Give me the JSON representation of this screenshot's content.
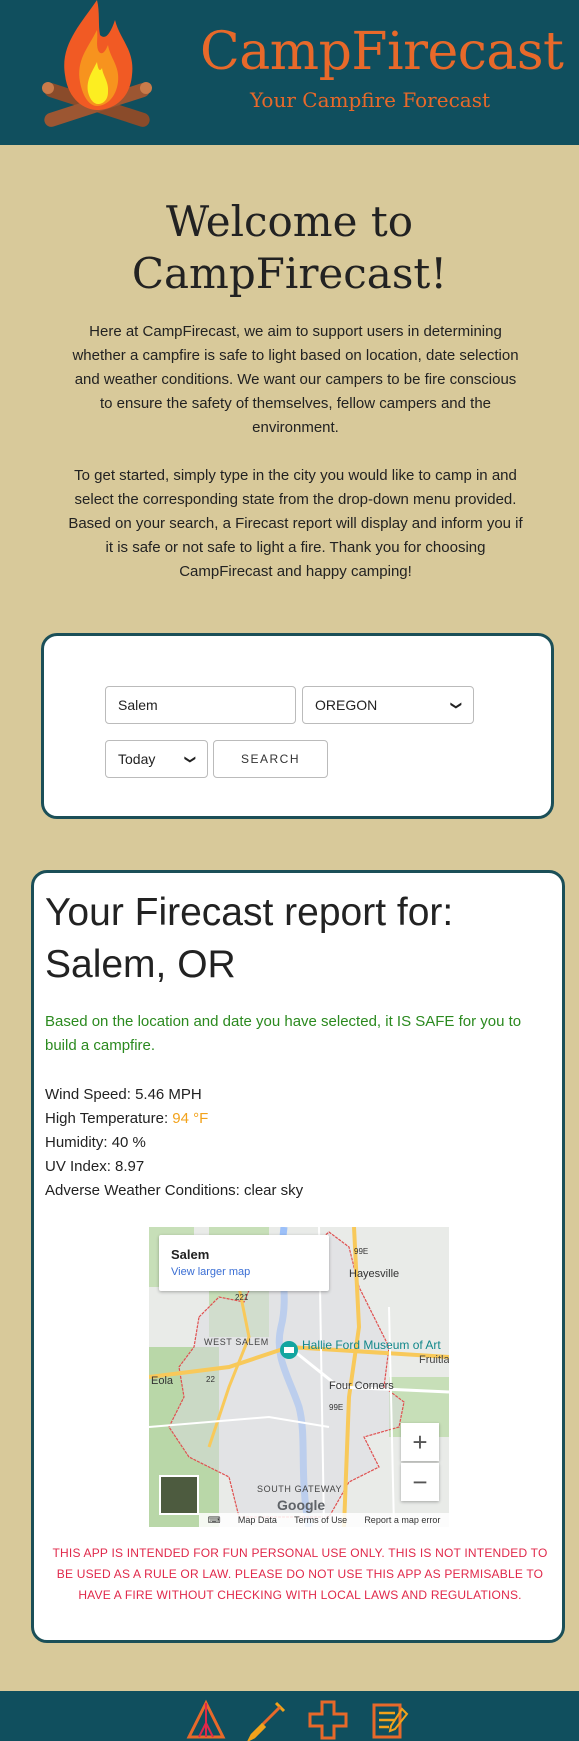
{
  "header": {
    "brand": "CampFirecast",
    "tagline": "Your Campfire Forecast",
    "logo_icon": "campfire-icon"
  },
  "welcome": {
    "title": "Welcome to CampFirecast!",
    "paragraph1": "Here at CampFirecast, we aim to support users in determining whether a campfire is safe to light based on location, date selection and weather conditions. We want our campers to be fire conscious to ensure the safety of themselves, fellow campers and the environment.",
    "paragraph2": "To get started, simply type in the city you would like to camp in and select the corresponding state from the drop-down menu provided. Based on your search, a Firecast report will display and inform you if it is safe or not safe to light a fire. Thank you for choosing CampFirecast and happy camping!"
  },
  "search": {
    "city_value": "Salem",
    "state_value": "OREGON",
    "date_value": "Today",
    "button_label": "SEARCH"
  },
  "report": {
    "title": "Your Firecast report for: Salem, OR",
    "safe_message": "Based on the location and date you have selected, it IS SAFE for you to build a campfire.",
    "wind_label": "Wind Speed:",
    "wind_value": "5.46 MPH",
    "temp_label": "High Temperature:",
    "temp_value": "94 °F",
    "humidity_label": "Humidity:",
    "humidity_value": "40 %",
    "uv_label": "UV Index:",
    "uv_value": "8.97",
    "weather_label": "Adverse Weather Conditions:",
    "weather_value": "clear sky",
    "disclaimer": "THIS APP IS INTENDED FOR FUN PERSONAL USE ONLY. THIS IS NOT INTENDED TO BE USED AS A RULE OR LAW. PLEASE DO NOT USE THIS APP AS PERMISABLE TO HAVE A FIRE WITHOUT CHECKING WITH LOCAL LAWS AND REGULATIONS."
  },
  "map": {
    "place_title": "Salem",
    "larger_map_link": "View larger map",
    "labels": {
      "hayesville": "Hayesville",
      "west_salem": "WEST SALEM",
      "museum": "Hallie Ford Museum of Art",
      "fruitland": "Fruitla",
      "eola": "Eola",
      "four_corners": "Four Corners",
      "south_gateway": "SOUTH GATEWAY",
      "hwy_99e_top": "99E",
      "hwy_221": "221",
      "hwy_22": "22",
      "hwy_99e_mid": "99E"
    },
    "zoom_in": "+",
    "zoom_out": "−",
    "google": "Google",
    "footer_keyboard": "⌨",
    "footer_map_data": "Map Data",
    "footer_terms": "Terms of Use",
    "footer_report": "Report a map error"
  },
  "footer": {
    "icons": [
      "tent-icon",
      "shovel-icon",
      "first-aid-icon",
      "notes-icon"
    ]
  },
  "colors": {
    "header_bg": "#104f5e",
    "page_bg": "#d8c99a",
    "brand_orange": "#e8692a",
    "safe_green": "#2b8a1f",
    "warm_orange": "#f2a21b",
    "disclaimer_red": "#e0284a"
  }
}
